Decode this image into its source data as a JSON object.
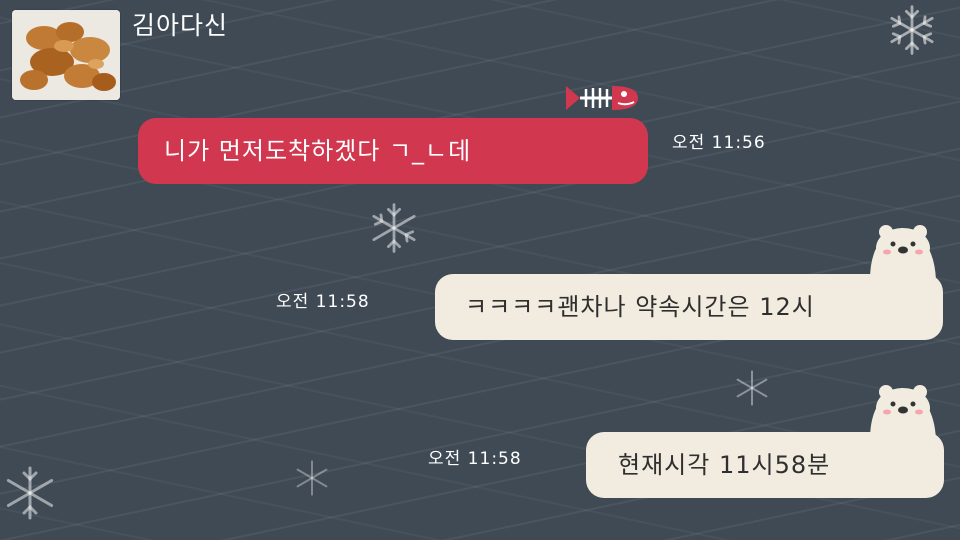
{
  "chat": {
    "sender_name": "김아다신",
    "avatar_icon": "fried-chicken-photo",
    "sticker_icon": "fish-bone-icon",
    "messages": [
      {
        "direction": "incoming",
        "text": "니가 먼저도착하겠다 ㄱ_ㄴ데",
        "time": "오전 11:56",
        "bubble_color": "#d1384f"
      },
      {
        "direction": "outgoing",
        "text": "ㅋㅋㅋㅋ괜차나 약속시간은 12시",
        "time": "오전 11:58",
        "bubble_color": "#f2ece0"
      },
      {
        "direction": "outgoing",
        "text": "현재시각 11시58분",
        "time": "오전 11:58",
        "bubble_color": "#f2ece0"
      }
    ]
  },
  "theme": {
    "background": "#3f4a55",
    "decorations": [
      "snowflake-icon",
      "polar-bear-icon"
    ]
  }
}
